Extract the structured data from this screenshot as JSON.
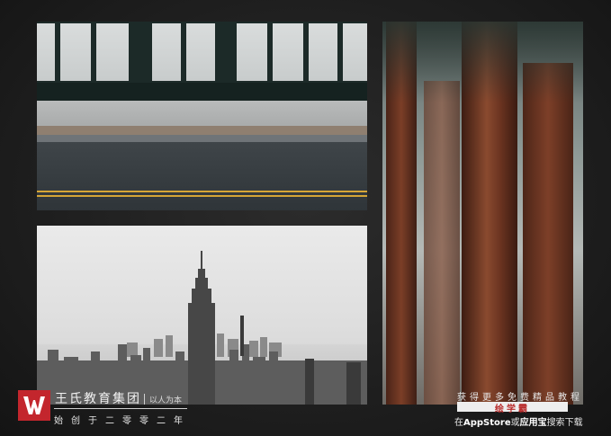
{
  "photos": {
    "street": "street-photo",
    "city": "city-skyline-photo",
    "forest": "redwood-forest-photo"
  },
  "brand": {
    "logo_icon": "w-logo-icon",
    "name": "王氏教育集团",
    "slogan": "以人为本",
    "founded": "始创于二零零二年",
    "color": "#c3262d"
  },
  "promo": {
    "line1": "获得更多免费精品教程",
    "badge": "绘学霸",
    "line2_prefix": "在",
    "line2_store1": "AppStore",
    "line2_or": "或",
    "line2_store2": "应用宝",
    "line2_suffix": "搜索下载"
  }
}
